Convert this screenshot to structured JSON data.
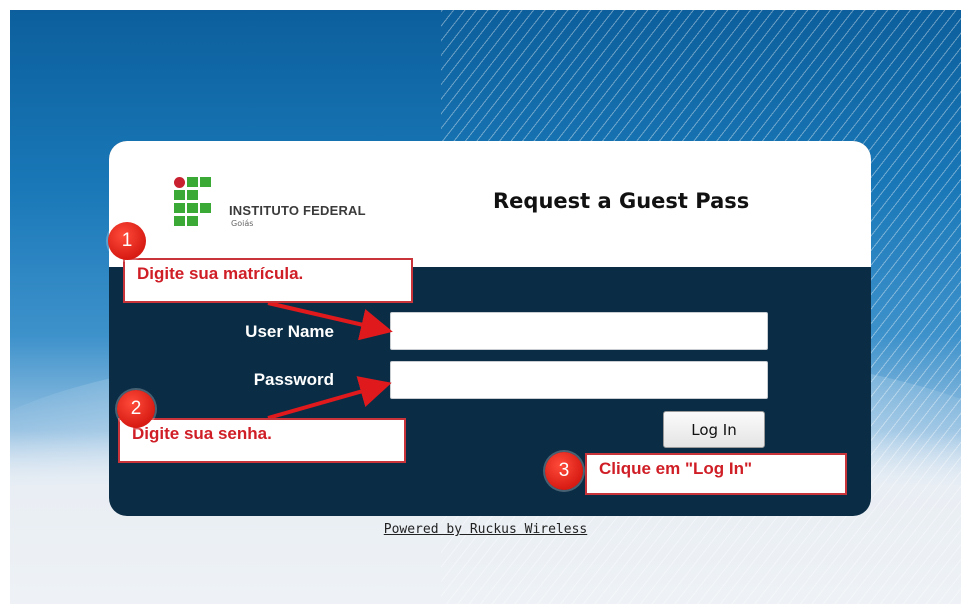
{
  "page": {
    "title": "Request a Guest Pass",
    "logo_name": "INSTITUTO FEDERAL",
    "logo_sub": "Goiás"
  },
  "form": {
    "username_label": "User Name",
    "username_value": "",
    "password_label": "Password",
    "password_value": "",
    "login_button": "Log In"
  },
  "annotations": [
    {
      "number": "1",
      "text": "Digite sua matrícula."
    },
    {
      "number": "2",
      "text": "Digite sua senha."
    },
    {
      "number": "3",
      "text": "Clique em \"Log In\""
    }
  ],
  "footer": {
    "powered_by": "Powered by Ruckus Wireless"
  },
  "colors": {
    "panel": "#0a2d45",
    "annotation_red": "#d01e26",
    "logo_green": "#3aa935",
    "logo_red": "#c8202e"
  }
}
